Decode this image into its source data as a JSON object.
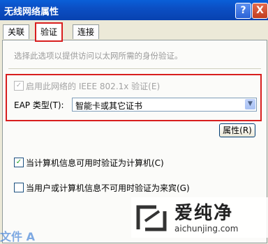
{
  "window": {
    "title": "无线网络属性",
    "help_button": "?",
    "close_button": "X"
  },
  "tabs": [
    {
      "label": "关联"
    },
    {
      "label": "验证"
    },
    {
      "label": "连接"
    }
  ],
  "hint_text": "选择此选项以提供访问以太网所需的身份验证。",
  "ieee_checkbox": {
    "label": "启用此网络的 IEEE 802.1x 验证(E)",
    "checked": true,
    "enabled": false
  },
  "eap": {
    "label": "EAP 类型(T):",
    "selected": "智能卡或其它证书"
  },
  "properties_button": "属性(R)",
  "auth_computer": {
    "label": "当计算机信息可用时验证为计算机(C)",
    "checked": true
  },
  "auth_guest": {
    "label": "当用户或计算机信息不可用时验证为来宾(G)",
    "checked": false
  },
  "watermark": {
    "brand": "爱纯净",
    "url": "aichunjing.com"
  },
  "bottom_fragment": "文件 A"
}
